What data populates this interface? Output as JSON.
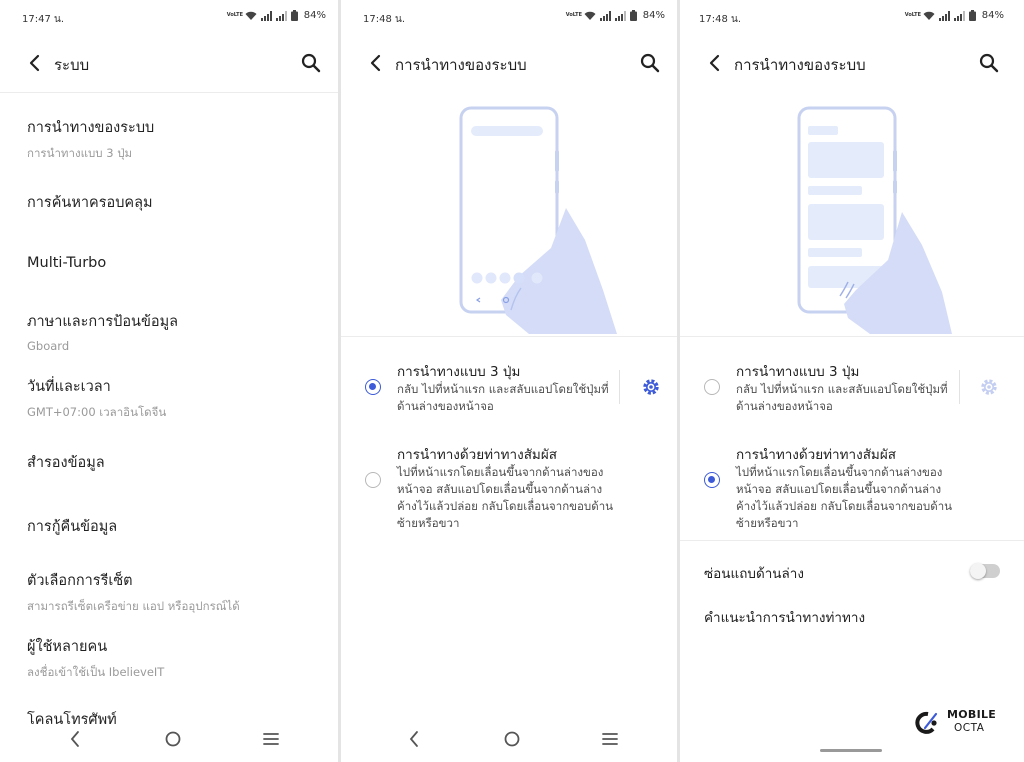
{
  "panel1": {
    "status": {
      "time": "17:47 น.",
      "net_tag": "VoLTE",
      "battery": "84%"
    },
    "title": "ระบบ",
    "items": [
      {
        "title": "การนำทางของระบบ",
        "subtitle": "การนำทางแบบ 3 ปุ่ม"
      },
      {
        "title": "การค้นหาครอบคลุม",
        "subtitle": ""
      },
      {
        "title": "Multi-Turbo",
        "subtitle": ""
      },
      {
        "title": "ภาษาและการป้อนข้อมูล",
        "subtitle": "Gboard"
      },
      {
        "title": "วันที่และเวลา",
        "subtitle": "GMT+07:00 เวลาอินโดจีน"
      },
      {
        "title": "สำรองข้อมูล",
        "subtitle": ""
      },
      {
        "title": "การกู้คืนข้อมูล",
        "subtitle": ""
      },
      {
        "title": "ตัวเลือกการรีเซ็ต",
        "subtitle": "สามารถรีเซ็ตเครือข่าย แอป หรืออุปกรณ์ได้"
      },
      {
        "title": "ผู้ใช้หลายคน",
        "subtitle": "ลงชื่อเข้าใช้เป็น IbelieveIT"
      },
      {
        "title": "โคลนโทรศัพท์",
        "subtitle": ""
      }
    ]
  },
  "panel2": {
    "status": {
      "time": "17:48 น.",
      "net_tag": "VoLTE",
      "battery": "84%"
    },
    "title": "การนำทางของระบบ",
    "options": [
      {
        "title": "การนำทางแบบ 3 ปุ่ม",
        "desc": "กลับ ไปที่หน้าแรก และสลับแอปโดยใช้ปุ่มที่ด้านล่างของหน้าจอ",
        "selected": true
      },
      {
        "title": "การนำทางด้วยท่าทางสัมผัส",
        "desc": "ไปที่หน้าแรกโดยเลื่อนขึ้นจากด้านล่างของหน้าจอ สลับแอปโดยเลื่อนขึ้นจากด้านล่างค้างไว้แล้วปล่อย กลับโดยเลื่อนจากขอบด้านซ้ายหรือขวา",
        "selected": false
      }
    ]
  },
  "panel3": {
    "status": {
      "time": "17:48 น.",
      "net_tag": "VoLTE",
      "battery": "84%"
    },
    "title": "การนำทางของระบบ",
    "options": [
      {
        "title": "การนำทางแบบ 3 ปุ่ม",
        "desc": "กลับ ไปที่หน้าแรก และสลับแอปโดยใช้ปุ่มที่ด้านล่างของหน้าจอ",
        "selected": false
      },
      {
        "title": "การนำทางด้วยท่าทางสัมผัส",
        "desc": "ไปที่หน้าแรกโดยเลื่อนขึ้นจากด้านล่างของหน้าจอ สลับแอปโดยเลื่อนขึ้นจากด้านล่างค้างไว้แล้วปล่อย กลับโดยเลื่อนจากขอบด้านซ้ายหรือขวา",
        "selected": true
      }
    ],
    "hide_bottom_bar": {
      "label": "ซ่อนแถบด้านล่าง",
      "on": false
    },
    "gesture_tips": "คำแนะนำการนำทางท่าทาง"
  },
  "watermark": {
    "line1": "MOBILE",
    "line2": "OCTA"
  },
  "colors": {
    "accent": "#3d5bd9",
    "illustration_hand": "#d4dcf7",
    "illustration_screen": "#e4ebfb"
  },
  "icons": [
    "back-arrow-icon",
    "search-icon",
    "settings-gear-icon",
    "wifi-icon",
    "signal-icon",
    "battery-icon",
    "nav-back-icon",
    "nav-home-icon",
    "nav-recents-icon"
  ]
}
